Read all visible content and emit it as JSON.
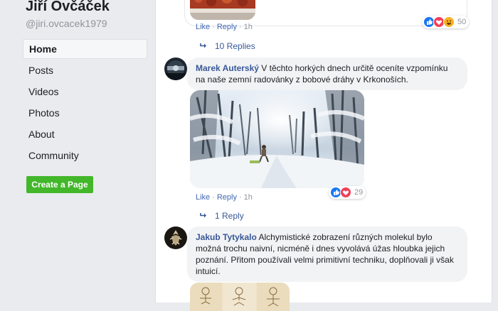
{
  "page": {
    "name": "Jiří Ovčáček",
    "handle": "@jiri.ovcacek1979"
  },
  "sidebar": {
    "items": [
      {
        "label": "Home"
      },
      {
        "label": "Posts"
      },
      {
        "label": "Videos"
      },
      {
        "label": "Photos"
      },
      {
        "label": "About"
      },
      {
        "label": "Community"
      }
    ],
    "active_index": 0,
    "create_page_label": "Create a Page"
  },
  "actions": {
    "like": "Like",
    "reply": "Reply",
    "separator": "·"
  },
  "comments": [
    {
      "time": "1h",
      "reaction_count": "50",
      "reactions": [
        "like",
        "love",
        "haha"
      ],
      "replies_label": "10 Replies"
    },
    {
      "author": "Marek Auterský",
      "text": "V těchto horkých dnech určitě oceníte vzpomínku na naše zemní radovánky z bobové dráhy v Krkonoších.",
      "time": "1h",
      "reaction_count": "29",
      "reactions": [
        "like",
        "love"
      ],
      "replies_label": "1 Reply"
    },
    {
      "author": "Jakub Tytykalo",
      "text": "Alchymistické zobrazení různých molekul bylo možná trochu naivní, nicméně i dnes vyvolává úžas hloubka jejich poznání. Přitom používali velmi primitivní techniku, doplňovali ji však intuicí."
    }
  ],
  "colors": {
    "link": "#385898",
    "action_link": "#4267b2",
    "create_button": "#42b72a",
    "bubble": "#f2f3f5",
    "page_bg": "#e9ebee"
  },
  "icons": [
    "reply-arrow-icon",
    "like-reaction-icon",
    "love-reaction-icon",
    "haha-reaction-icon"
  ]
}
